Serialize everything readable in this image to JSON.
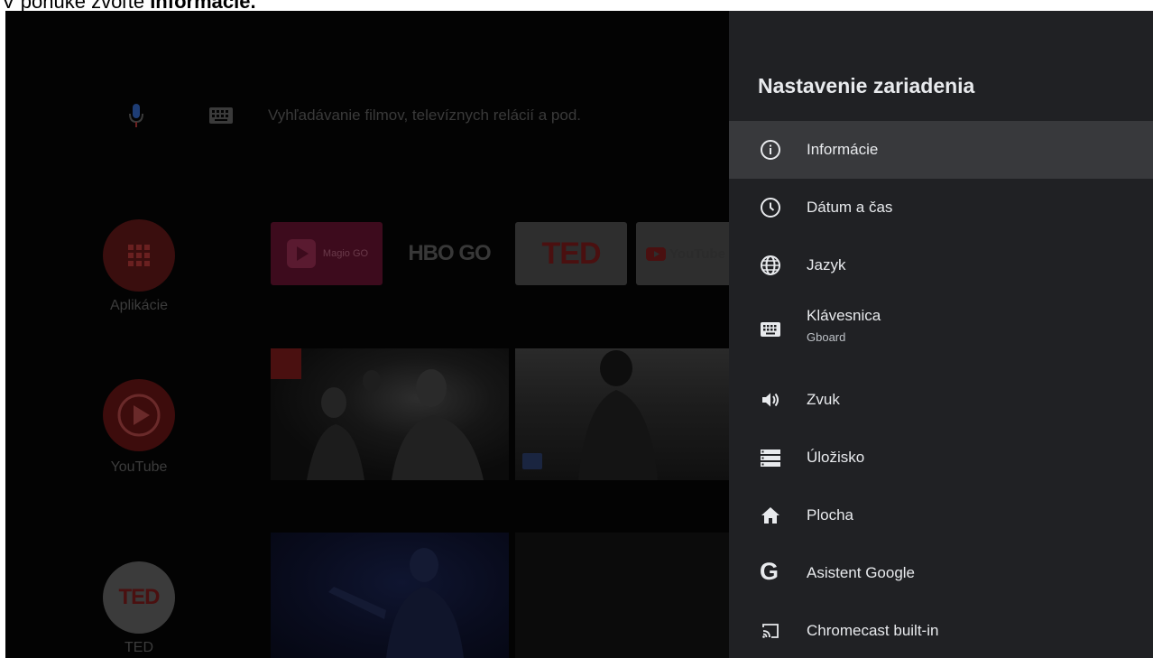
{
  "caption": {
    "prefix": "V ponuke zvoľte ",
    "emphasis": "Informácie."
  },
  "home": {
    "search_placeholder": "Vyhľadávanie filmov, televíznych relácií a pod.",
    "side_apps": [
      {
        "label": "Aplikácie"
      },
      {
        "label": "YouTube"
      },
      {
        "label": "TED",
        "logo_text": "TED"
      }
    ],
    "channels": [
      {
        "name": "Magio GO"
      },
      {
        "name": "HBO GO"
      },
      {
        "name": "TED"
      },
      {
        "name": "YouTube"
      }
    ]
  },
  "panel": {
    "title": "Nastavenie zariadenia",
    "items": [
      {
        "label": "Informácie",
        "icon": "info-icon",
        "selected": true
      },
      {
        "label": "Dátum a čas",
        "icon": "clock-icon"
      },
      {
        "label": "Jazyk",
        "icon": "globe-icon"
      },
      {
        "label": "Klávesnica",
        "sub": "Gboard",
        "icon": "keyboard-icon"
      },
      {
        "label": "Zvuk",
        "icon": "volume-icon"
      },
      {
        "label": "Úložisko",
        "icon": "storage-icon"
      },
      {
        "label": "Plocha",
        "icon": "home-icon"
      },
      {
        "label": "Asistent Google",
        "icon": "google-icon",
        "icon_glyph": "G"
      },
      {
        "label": "Chromecast built-in",
        "icon": "cast-icon"
      }
    ]
  },
  "colors": {
    "panel_bg": "#202124",
    "selected_bg": "#38393c",
    "text_primary": "#e8eaed",
    "text_secondary": "#bdc1c6"
  }
}
